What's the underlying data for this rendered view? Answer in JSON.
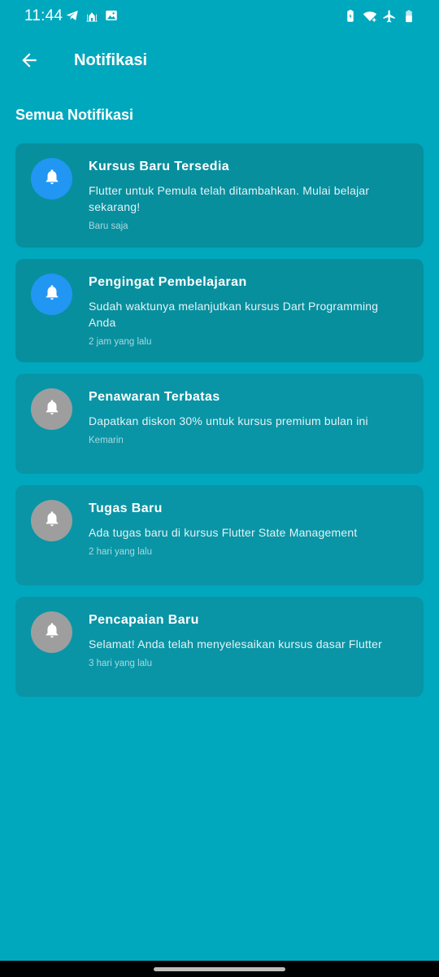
{
  "status_bar": {
    "time": "11:44",
    "left_icons": [
      "telegram-icon",
      "mosque-icon",
      "image-icon"
    ],
    "right_icons": [
      "battery-saver-icon",
      "wifi-icon",
      "airplane-icon",
      "battery-icon"
    ]
  },
  "app_bar": {
    "back_icon": "arrow-left-icon",
    "title": "Notifikasi"
  },
  "section_title": "Semua Notifikasi",
  "notifications": [
    {
      "title": "Kursus Baru Tersedia",
      "message": "Flutter untuk Pemula telah ditambahkan. Mulai belajar sekarang!",
      "time": "Baru saja",
      "icon": "bell-icon",
      "icon_color": "#2196F3",
      "unread": true
    },
    {
      "title": "Pengingat Pembelajaran",
      "message": "Sudah waktunya melanjutkan kursus Dart Programming Anda",
      "time": "2 jam yang lalu",
      "icon": "bell-icon",
      "icon_color": "#2196F3",
      "unread": true
    },
    {
      "title": "Penawaran Terbatas",
      "message": "Dapatkan diskon 30% untuk kursus premium bulan ini",
      "time": "Kemarin",
      "icon": "bell-icon",
      "icon_color": "#9E9E9E",
      "unread": false
    },
    {
      "title": "Tugas Baru",
      "message": "Ada tugas baru di kursus Flutter State Management",
      "time": "2 hari yang lalu",
      "icon": "bell-icon",
      "icon_color": "#9E9E9E",
      "unread": false
    },
    {
      "title": "Pencapaian Baru",
      "message": "Selamat! Anda telah menyelesaikan kursus dasar Flutter",
      "time": "3 hari yang lalu",
      "icon": "bell-icon",
      "icon_color": "#9E9E9E",
      "unread": false
    }
  ],
  "colors": {
    "background": "#00A8BE",
    "card_unread": "#078F9E",
    "card_read": "#0995A6",
    "accent_blue": "#2196F3",
    "muted_grey": "#9E9E9E"
  }
}
